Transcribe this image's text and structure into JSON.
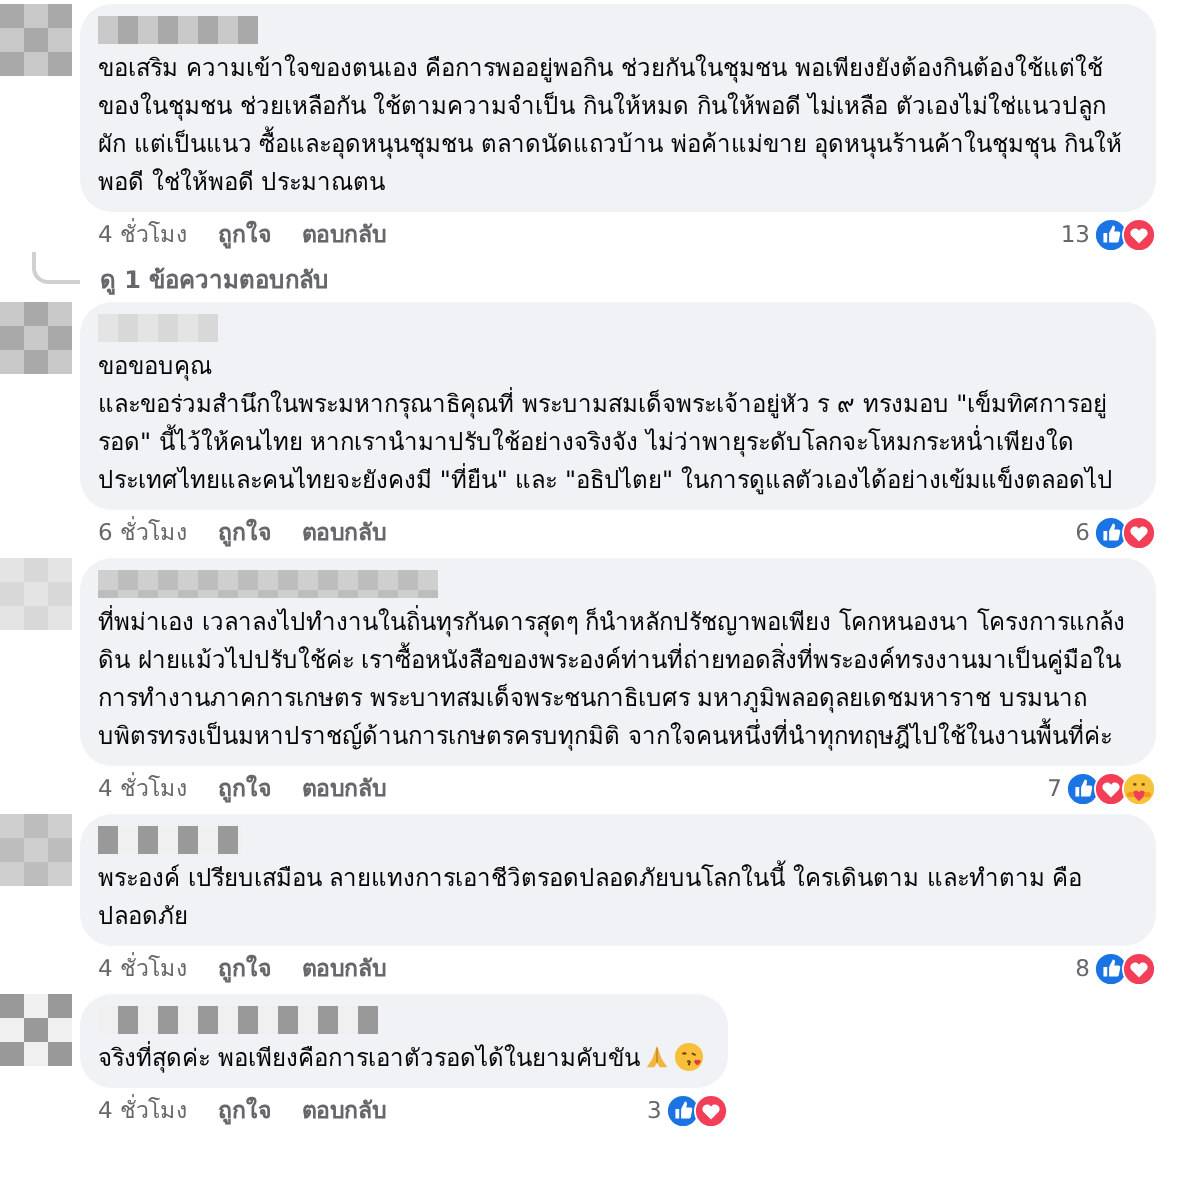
{
  "comments": [
    {
      "text": "ขอเสริม ความเข้าใจของตนเอง คือการพออยู่พอกิน ช่วยกันในชุมชน พอเพียงยังต้องกินต้องใช้แต่ใช้ของในชุมชน ช่วยเหลือกัน ใช้ตามความจำเป็น กินให้หมด กินให้พอดี ไม่เหลือ ตัวเองไม่ใช่แนวปลูกผัก แต่เป็นแนว ซื้อและอุดหนุนชุมชน ตลาดนัดแถวบ้าน พ่อค้าแม่ขาย อุดหนุนร้านค้าในชุมชุน กินให้พอดี ใช่ให้พอดี ประมาณตน",
      "time": "4 ชั่วโมง",
      "like_label": "ถูกใจ",
      "reply_label": "ตอบกลับ",
      "reaction_count": "13",
      "reactions": [
        {
          "kind": "like"
        },
        {
          "kind": "love"
        }
      ],
      "replies_link": "ดู 1 ข้อความตอบกลับ"
    },
    {
      "text": "ขอขอบคุณ\nและขอร่วมสำนึกในพระมหากรุณาธิคุณที่ พระบามสมเด็จพระเจ้าอยู่หัว ร ๙ ทรงมอบ \"เข็มทิศการอยู่รอด\" นี้ไว้ให้คนไทย หากเรานำมาปรับใช้อย่างจริงจัง ไม่ว่าพายุระดับโลกจะโหมกระหน่ำเพียงใด ประเทศไทยและคนไทยจะยังคงมี \"ที่ยืน\" และ \"อธิปไตย\" ในการดูแลตัวเองได้อย่างเข้มแข็งตลอดไป",
      "time": "6 ชั่วโมง",
      "like_label": "ถูกใจ",
      "reply_label": "ตอบกลับ",
      "reaction_count": "6",
      "reactions": [
        {
          "kind": "like"
        },
        {
          "kind": "love"
        }
      ]
    },
    {
      "text": "ที่พม่าเอง เวลาลงไปทำงานในถิ่นทุรกันดารสุดๆ ก็นำหลักปรัชญาพอเพียง โคกหนองนา โครงการแกล้งดิน ฝายแม้วไปปรับใช้ค่ะ เราซื้อหนังสือของพระองค์ท่านที่ถ่ายทอดสิ่งที่พระองค์ทรงงานมาเป็นคู่มือในการทำงานภาคการเกษตร พระบาทสมเด็จพระชนกาธิเบศร มหาภูมิพลอดุลยเดชมหาราช บรมนาถบพิตรทรงเป็นมหาปราชญ์ด้านการเกษตรครบทุกมิติ จากใจคนหนึ่งที่นำทุกทฤษฎีไปใช้ในงานพื้นที่ค่ะ",
      "time": "4 ชั่วโมง",
      "like_label": "ถูกใจ",
      "reply_label": "ตอบกลับ",
      "reaction_count": "7",
      "reactions": [
        {
          "kind": "like"
        },
        {
          "kind": "love"
        },
        {
          "kind": "care"
        }
      ]
    },
    {
      "text": "พระองค์ เปรียบเสมือน ลายแทงการเอาชีวิตรอดปลอดภัยบนโลกในนี้ ใครเดินตาม และทำตาม คือปลอดภัย",
      "time": "4 ชั่วโมง",
      "like_label": "ถูกใจ",
      "reply_label": "ตอบกลับ",
      "reaction_count": "8",
      "reactions": [
        {
          "kind": "like"
        },
        {
          "kind": "love"
        }
      ]
    },
    {
      "text": "จริงที่สุดค่ะ พอเพียงคือการเอาตัวรอดได้ในยามคับขัน",
      "emojis": [
        {
          "kind": "pray"
        },
        {
          "kind": "kiss"
        }
      ],
      "time": "4 ชั่วโมง",
      "like_label": "ถูกใจ",
      "reply_label": "ตอบกลับ",
      "reaction_count": "3",
      "reactions": [
        {
          "kind": "like"
        },
        {
          "kind": "love"
        }
      ]
    }
  ]
}
